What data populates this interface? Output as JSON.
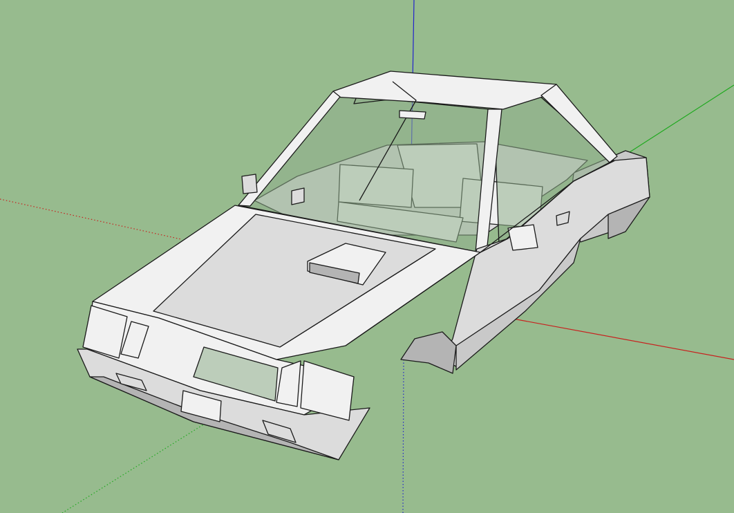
{
  "app": {
    "title": ""
  },
  "scene": {
    "background_color": "#97bb8e",
    "axis_colors": {
      "red": "#c8201e",
      "green": "#1ea91e",
      "blue": "#2222cc"
    },
    "face_colors": {
      "light": "#f1f1f1",
      "mid": "#dcdcdc",
      "shade": "#c9c9c9",
      "dark": "#b4b4b4",
      "glass": "#8fae8c"
    },
    "model_name": "",
    "icons": [
      "red-axis-line",
      "green-axis-line",
      "blue-axis-line",
      "car-model"
    ]
  }
}
